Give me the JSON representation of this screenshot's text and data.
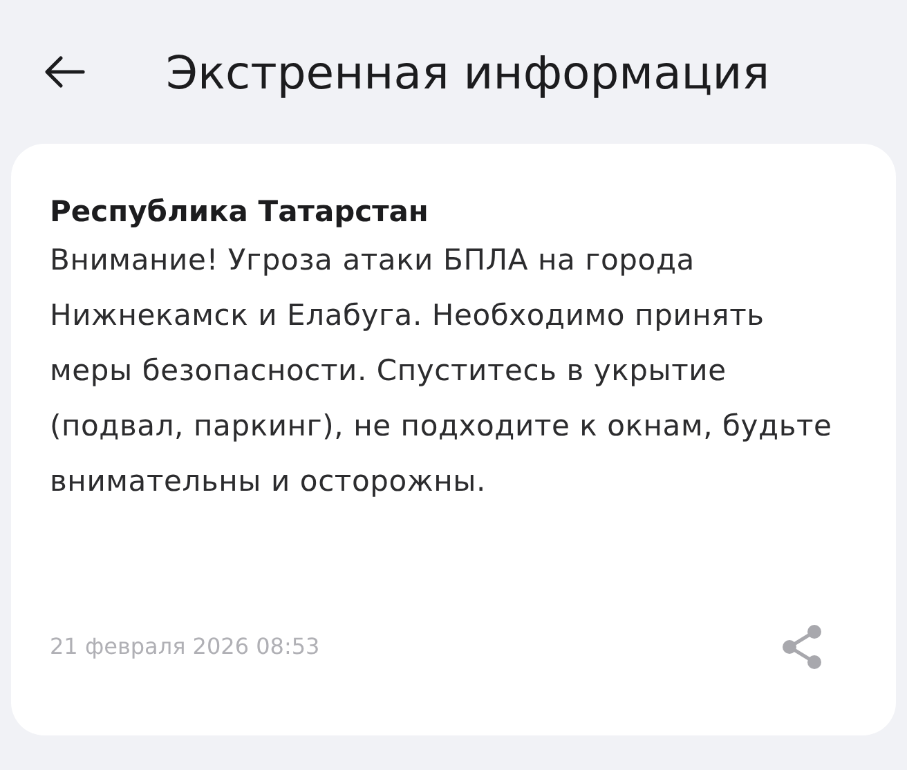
{
  "header": {
    "title": "Экстренная информация"
  },
  "message": {
    "region": "Республика Татарстан",
    "text": "Внимание! Угроза атаки БПЛА на города Нижнекамск и Елабуга. Необходимо принять меры безопасности. Спуститесь в укрытие (подвал, паркинг), не подходите к окнам, будьте внимательны и осторожны.",
    "timestamp": "21 февраля 2026 08:53"
  }
}
